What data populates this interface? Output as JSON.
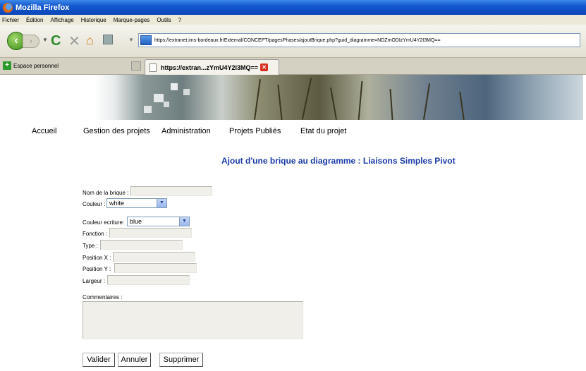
{
  "browser": {
    "window_title": "Mozilla Firefox",
    "menu": [
      "Fichier",
      "Édition",
      "Affichage",
      "Historique",
      "Marque-pages",
      "Outils",
      "?"
    ],
    "url": "https://extranet.ims-bordeaux.fr/External/CONCEPT/pagesPhases/ajoutBrique.php?guid_diagramme=NDZmODIzYmU4Y2I3MQ==",
    "bookmark_personal": "Espace personnel",
    "tab_title": "https://extran...zYmU4Y2I3MQ=="
  },
  "site_nav": [
    "Accueil",
    "Gestion des projets",
    "Administration",
    "Projets Publiés",
    "Etat du projet"
  ],
  "page_title": "Ajout d'une brique au diagramme : Liaisons Simples Pivot",
  "form": {
    "name_label": "Nom de la brique :",
    "color_label": "Couleur :",
    "color_value": "white",
    "text_color_label": "Couleur ecriture:",
    "text_color_value": "blue",
    "function_label": "Fonction :",
    "type_label": "Type :",
    "posx_label": "Position X :",
    "posy_label": "Position Y :",
    "width_label": "Largeur :",
    "comments_label": "Commentaires :",
    "validate": "Valider",
    "cancel": "Annuler",
    "delete": "Supprimer"
  }
}
